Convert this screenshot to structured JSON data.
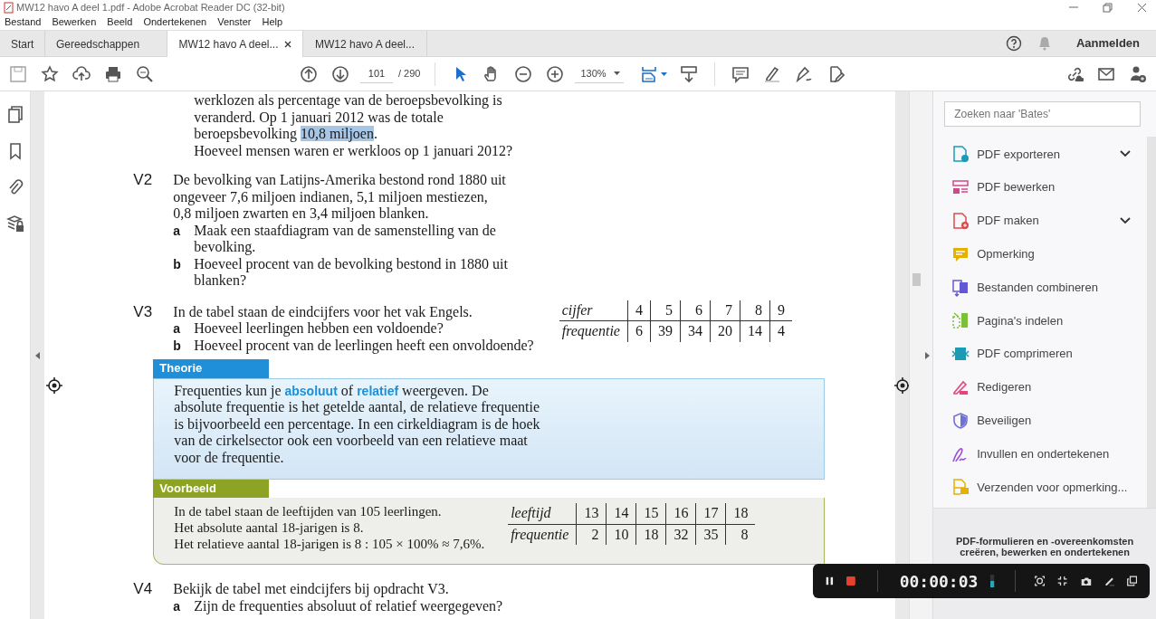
{
  "window": {
    "title": "MW12 havo A deel 1.pdf - Adobe Acrobat Reader DC (32-bit)"
  },
  "menu": [
    "Bestand",
    "Bewerken",
    "Beeld",
    "Ondertekenen",
    "Venster",
    "Help"
  ],
  "tabs": [
    {
      "label": "Start",
      "selected": false,
      "kind": "nav"
    },
    {
      "label": "Gereedschappen",
      "selected": false,
      "kind": "nav"
    },
    {
      "label": "MW12 havo A deel...",
      "selected": true,
      "kind": "doc",
      "closable": true
    },
    {
      "label": "MW12 havo A deel...",
      "selected": false,
      "kind": "doc",
      "closable": false
    }
  ],
  "sign_in": "Aanmelden",
  "toolbar": {
    "page": "101",
    "page_total": "/ 290",
    "zoom": "130%"
  },
  "document": {
    "intro": [
      [
        {
          "text": "werklozen als percentage van de beroepsbevolking is",
          "highlighted": false
        }
      ],
      [
        {
          "text": "veranderd. Op 1 januari 2012 was de totale",
          "highlighted": false
        }
      ],
      [
        {
          "text": "beroepsbevolking ",
          "highlighted": false
        },
        {
          "text": "10,8 miljoen",
          "highlighted": true
        },
        {
          "text": ".",
          "highlighted": false
        }
      ],
      [
        {
          "text": "Hoeveel mensen waren er werkloos op 1 januari 2012?",
          "highlighted": false
        }
      ]
    ],
    "questions": [
      {
        "number": "V2",
        "lines": [
          "De bevolking van Latijns-Amerika bestond rond 1880 uit",
          "ongeveer 7,6 miljoen indianen, 5,1 miljoen mestiezen,",
          "0,8 miljoen zwarten en 3,4 miljoen blanken."
        ],
        "parts": [
          {
            "letter": "a",
            "lines": [
              "Maak een staafdiagram van de samenstelling van de",
              "bevolking."
            ]
          },
          {
            "letter": "b",
            "lines": [
              "Hoeveel procent van de bevolking bestond in 1880 uit",
              "blanken?"
            ]
          }
        ]
      },
      {
        "number": "V3",
        "lines": [
          "In de tabel staan de eindcijfers voor het vak Engels."
        ],
        "parts": [
          {
            "letter": "a",
            "lines": [
              "Hoeveel leerlingen hebben een voldoende?"
            ]
          },
          {
            "letter": "b",
            "lines": [
              "Hoeveel procent van de leerlingen heeft een onvoldoende?"
            ]
          }
        ],
        "table": {
          "head": "cijfer",
          "head_values": [
            "4",
            "5",
            "6",
            "7",
            "8",
            "9"
          ],
          "label": "frequentie",
          "values": [
            "6",
            "39",
            "34",
            "20",
            "14",
            "4"
          ]
        }
      }
    ],
    "theory": {
      "title": "Theorie",
      "lines": [
        "Frequenties kun je **absoluut** of **relatief** weergeven. De",
        "absolute frequentie is het getelde aantal, de relatieve frequentie",
        "is bijvoorbeeld een percentage. In een cirkeldiagram is de hoek",
        "van de cirkelsector ook een voorbeeld van een relatieve maat",
        "voor de frequentie."
      ]
    },
    "example": {
      "title": "Voorbeeld",
      "lines": [
        "In de tabel staan de leeftijden van 105 leerlingen.",
        "Het absolute aantal 18-jarigen is 8.",
        "Het relatieve aantal 18-jarigen is 8 : 105 × 100% ≈ 7,6%."
      ],
      "table": {
        "head": "leeftijd",
        "head_values": [
          "13",
          "14",
          "15",
          "16",
          "17",
          "18"
        ],
        "label": "frequentie",
        "values": [
          "2",
          "10",
          "18",
          "32",
          "35",
          "8"
        ]
      }
    },
    "next_question": {
      "number": "V4",
      "lines": [
        "Bekijk de tabel met eindcijfers bij opdracht V3."
      ],
      "parts": [
        {
          "letter": "a",
          "lines": [
            "Zijn de frequenties absoluut of relatief weergegeven?"
          ]
        }
      ]
    }
  },
  "tools_panel": {
    "search_placeholder": "Zoeken naar 'Bates'",
    "tools": [
      {
        "label": "PDF exporteren",
        "color": "#1c9bb5",
        "expandable": true
      },
      {
        "label": "PDF bewerken",
        "color": "#d2488a",
        "expandable": false
      },
      {
        "label": "PDF maken",
        "color": "#dc4b4b",
        "expandable": true
      },
      {
        "label": "Opmerking",
        "color": "#e6b000",
        "expandable": false
      },
      {
        "label": "Bestanden combineren",
        "color": "#6457d6",
        "expandable": false
      },
      {
        "label": "Pagina's indelen",
        "color": "#7cbf3c",
        "expandable": false
      },
      {
        "label": "PDF comprimeren",
        "color": "#1c9bb5",
        "expandable": false
      },
      {
        "label": "Redigeren",
        "color": "#e0457b",
        "expandable": false
      },
      {
        "label": "Beveiligen",
        "color": "#6f6fd6",
        "expandable": false
      },
      {
        "label": "Invullen en ondertekenen",
        "color": "#9b4fd6",
        "expandable": false
      },
      {
        "label": "Verzenden voor opmerking...",
        "color": "#e6b000",
        "expandable": false
      }
    ],
    "footer": [
      "PDF-formulieren en -overeenkomsten",
      "creëren, bewerken en ondertekenen"
    ]
  },
  "recorder": {
    "time": "00:00:03"
  }
}
